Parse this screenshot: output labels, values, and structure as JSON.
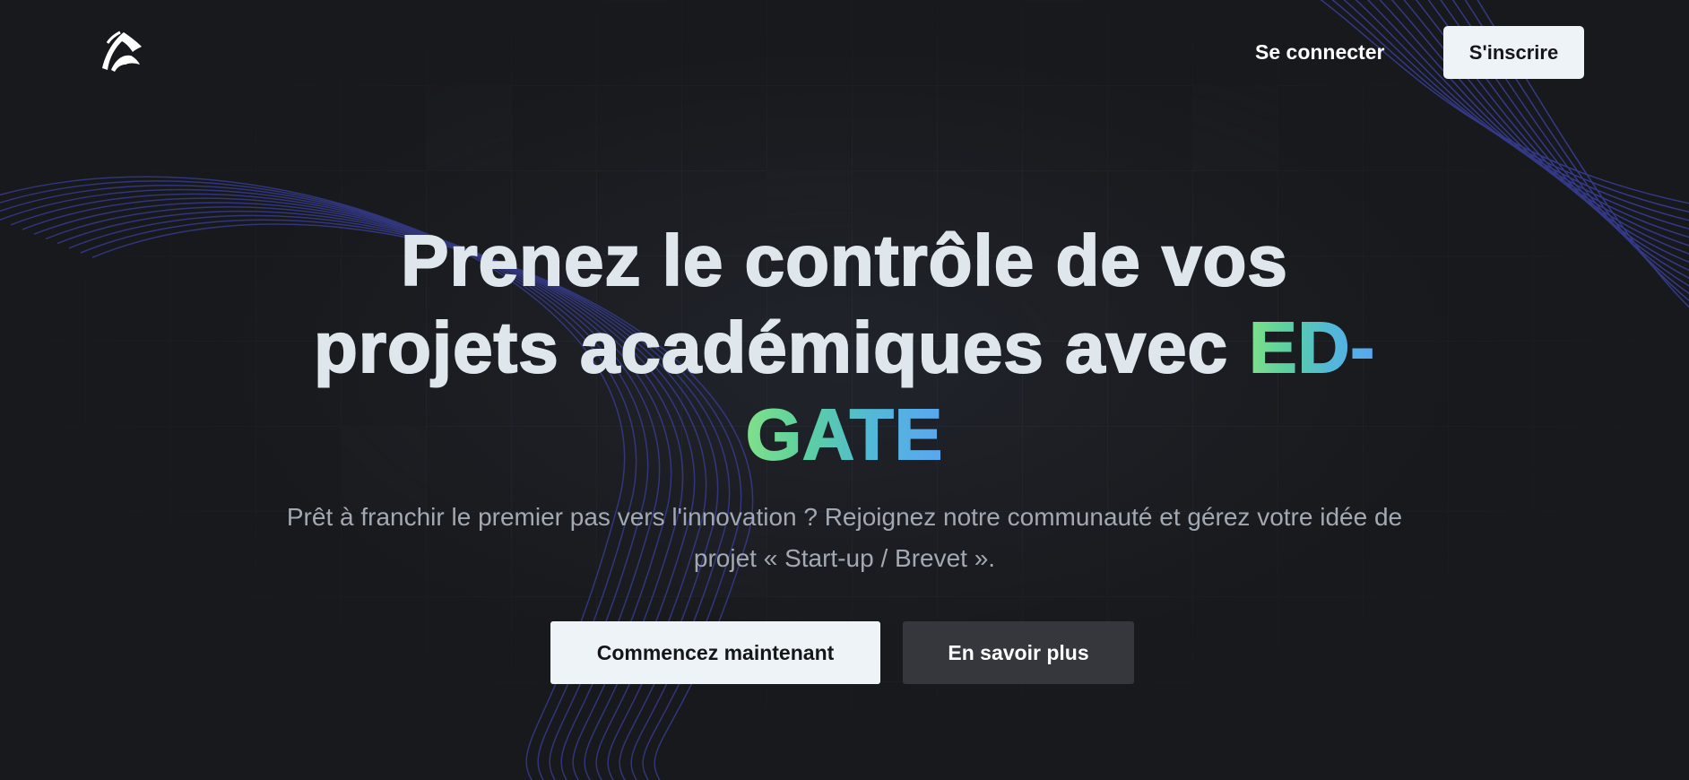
{
  "header": {
    "logo_icon": "ed-gate-logo-icon",
    "login_label": "Se connecter",
    "signup_label": "S'inscrire"
  },
  "hero": {
    "title_line1": "Prenez le contrôle de vos",
    "title_line2_prefix": "projets académiques avec ",
    "title_brand_part1": "ED-",
    "title_brand_part2": "GATE",
    "subtitle_line1": "Prêt à franchir le premier pas vers l'innovation ? Rejoignez notre communauté et gérez votre idée de",
    "subtitle_line2": "projet « Start-up / Brevet ».",
    "cta_primary_label": "Commencez maintenant",
    "cta_secondary_label": "En savoir plus"
  },
  "colors": {
    "background": "#18191c",
    "title": "#dfe7ed",
    "subtitle": "#a2a9b2",
    "button_light": "#eef3f7",
    "button_dark": "#35373c",
    "brand_gradient_start": "#7fe08a",
    "brand_gradient_end": "#5aa6f0",
    "wave_lines": "#3a3f9a"
  }
}
